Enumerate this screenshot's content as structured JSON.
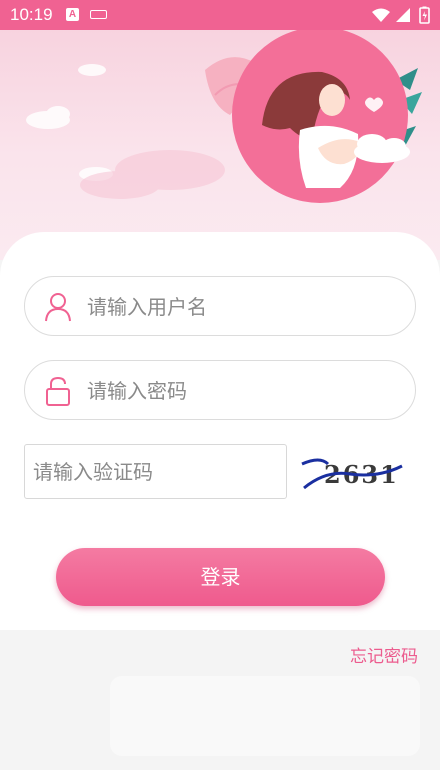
{
  "status_bar": {
    "time": "10:19",
    "a_icon": "A",
    "icons": [
      "keyboard-icon",
      "wifi-icon",
      "signal-icon",
      "battery-icon"
    ]
  },
  "login": {
    "username_placeholder": "请输入用户名",
    "password_placeholder": "请输入密码",
    "captcha_placeholder": "请输入验证码",
    "captcha_code": "2631",
    "login_button": "登录",
    "forgot_password": "忘记密码"
  },
  "colors": {
    "brand_pink": "#f06292",
    "button_pink": "#ef5a8d",
    "link_pink": "#ec5c8e",
    "header_bg": "#f8d3df"
  }
}
